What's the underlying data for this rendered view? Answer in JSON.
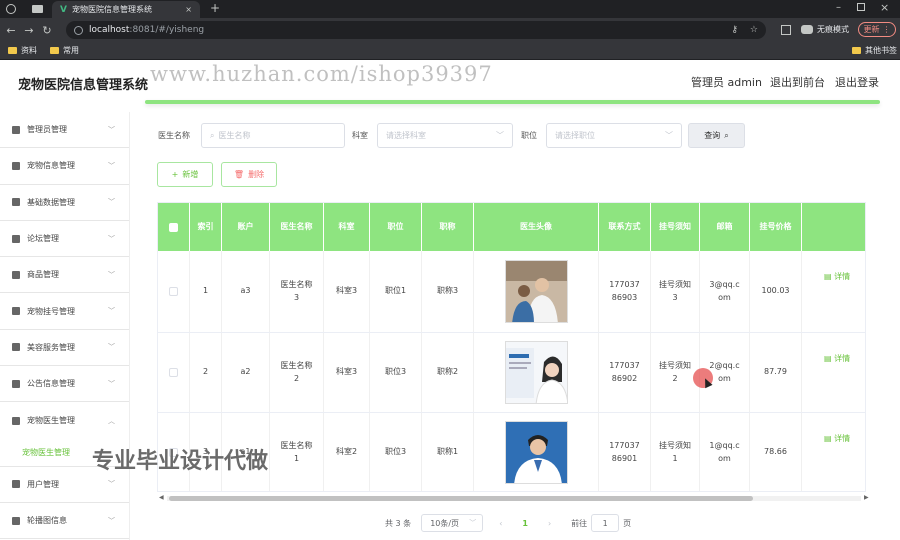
{
  "browser": {
    "tabs": [
      {
        "title": "宠物医院信息管理系统"
      }
    ],
    "url_host": "localhost",
    "url_path": ":8081/#/yisheng",
    "profile_label": "无痕模式",
    "update_label": "更新",
    "bookmarks": [
      "资料",
      "常用"
    ],
    "other_bookmarks": "其他书签"
  },
  "header": {
    "title": "宠物医院信息管理系统",
    "user": "管理员 admin",
    "front_link": "退出到前台",
    "logout_link": "退出登录"
  },
  "watermark": "www.huzhan.com/ishop39397",
  "overlay_text": "专业毕业设计代做",
  "sidebar": {
    "items": [
      {
        "label": "管理员管理",
        "icon": "user-cog-icon"
      },
      {
        "label": "宠物信息管理",
        "icon": "grid-icon"
      },
      {
        "label": "基础数据管理",
        "icon": "send-icon"
      },
      {
        "label": "论坛管理",
        "icon": "chat-icon"
      },
      {
        "label": "商品管理",
        "icon": "flag-icon"
      },
      {
        "label": "宠物挂号管理",
        "icon": "lock-icon"
      },
      {
        "label": "美容服务管理",
        "icon": "badge-icon"
      },
      {
        "label": "公告信息管理",
        "icon": "lock-icon"
      },
      {
        "label": "宠物医生管理",
        "icon": "doc-icon"
      },
      {
        "label": "用户管理",
        "icon": "shield-icon"
      },
      {
        "label": "轮播图信息",
        "icon": "mic-icon"
      }
    ],
    "active_sub": "宠物医生管理"
  },
  "filters": {
    "doctor_name_label": "医生名称",
    "doctor_name_placeholder": "医生名称",
    "dept_label": "科室",
    "dept_placeholder": "请选择科室",
    "position_label": "职位",
    "position_placeholder": "请选择职位",
    "query_button": "查询"
  },
  "actions": {
    "add": "新增",
    "delete": "删除"
  },
  "table": {
    "columns": [
      "索引",
      "账户",
      "医生名称",
      "科室",
      "职位",
      "职称",
      "医生头像",
      "联系方式",
      "挂号须知",
      "邮箱",
      "挂号价格"
    ],
    "rows": [
      {
        "index": "1",
        "account": "a3",
        "name": "医生名称3",
        "dept": "科室3",
        "position": "职位1",
        "title": "职称3",
        "phone": "17703786903",
        "notice": "挂号须知3",
        "email": "3@qq.com",
        "price": "100.03"
      },
      {
        "index": "2",
        "account": "a2",
        "name": "医生名称2",
        "dept": "科室3",
        "position": "职位3",
        "title": "职称2",
        "phone": "17703786902",
        "notice": "挂号须知2",
        "email": "2@qq.com",
        "price": "87.79"
      },
      {
        "index": "3",
        "account": "a1",
        "name": "医生名称1",
        "dept": "科室2",
        "position": "职位3",
        "title": "职称1",
        "phone": "17703786901",
        "notice": "挂号须知1",
        "email": "1@qq.com",
        "price": "78.66"
      }
    ],
    "detail_label": "详情"
  },
  "pagination": {
    "total": "共 3 条",
    "page_size": "10条/页",
    "current_page": "1",
    "goto_label": "前往",
    "goto_value": "1",
    "page_suffix": "页"
  },
  "colors": {
    "accent": "#8ee480",
    "accent_text": "#67c23a"
  }
}
